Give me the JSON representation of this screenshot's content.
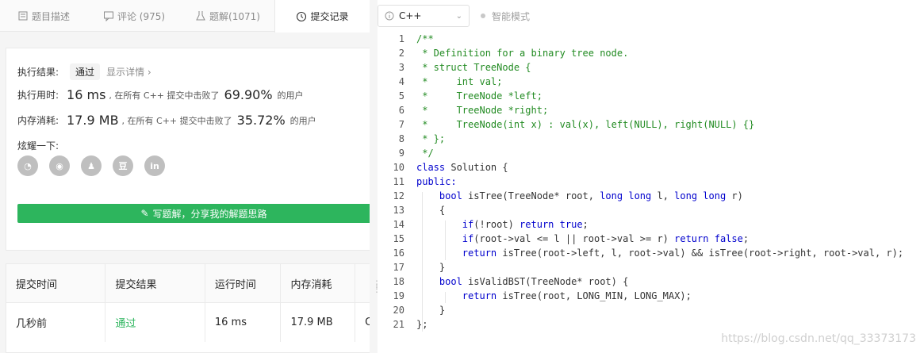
{
  "tabs": [
    {
      "label": "题目描述",
      "icon": "document-icon"
    },
    {
      "label": "评论 (975)",
      "icon": "comment-icon"
    },
    {
      "label": "题解(1071)",
      "icon": "flask-icon"
    },
    {
      "label": "提交记录",
      "icon": "clock-icon"
    }
  ],
  "result": {
    "status_label": "执行结果:",
    "status_value": "通过",
    "detail_link": "显示详情 ›",
    "time_label": "执行用时:",
    "time_value": "16 ms",
    "time_text": ", 在所有 C++ 提交中击败了",
    "time_pct": "69.90%",
    "time_suffix": "的用户",
    "mem_label": "内存消耗:",
    "mem_value": "17.9 MB",
    "mem_text": ", 在所有 C++ 提交中击败了",
    "mem_pct": "35.72%",
    "mem_suffix": "的用户",
    "share_label": "炫耀一下:",
    "share_icons": [
      "wechat-icon",
      "weibo-icon",
      "qq-icon",
      "douban-icon",
      "linkedin-icon"
    ],
    "share_button": "写题解，分享我的解题思路"
  },
  "submissions": {
    "headers": [
      "提交时间",
      "提交结果",
      "运行时间",
      "内存消耗",
      ""
    ],
    "rows": [
      {
        "time": "几秒前",
        "result": "通过",
        "runtime": "16 ms",
        "memory": "17.9 MB",
        "extra": "C"
      }
    ]
  },
  "editor": {
    "language": "C++",
    "smart_mode": "智能模式",
    "code_lines": [
      "/**",
      " * Definition for a binary tree node.",
      " * struct TreeNode {",
      " *     int val;",
      " *     TreeNode *left;",
      " *     TreeNode *right;",
      " *     TreeNode(int x) : val(x), left(NULL), right(NULL) {}",
      " * };",
      " */",
      "class Solution {",
      "public:",
      "    bool isTree(TreeNode* root, long long l, long long r)",
      "    {",
      "        if(!root) return true;",
      "        if(root->val <= l || root->val >= r) return false;",
      "        return isTree(root->left, l, root->val) && isTree(root->right, root->val, r);",
      "    }",
      "    bool isValidBST(TreeNode* root) {",
      "        return isTree(root, LONG_MIN, LONG_MAX);",
      "    }",
      "};"
    ]
  },
  "watermark": "https://blog.csdn.net/qq_33373173",
  "colors": {
    "accent_green": "#2db55d",
    "comment": "#228b22",
    "keyword": "#0000cd"
  }
}
